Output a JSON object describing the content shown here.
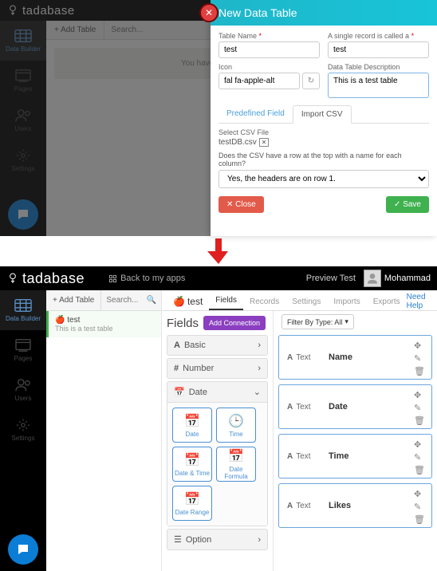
{
  "brand": "tadabase",
  "back_link": "Back to my apps",
  "sidebar": {
    "items": [
      {
        "label": "Data Builder"
      },
      {
        "label": "Pages"
      },
      {
        "label": "Users"
      },
      {
        "label": "Settings"
      }
    ]
  },
  "top": {
    "add_table": "+ Add Table",
    "search_placeholder": "Search...",
    "no_tables_msg": "You haven't created any tables yet"
  },
  "modal": {
    "title": "New Data Table",
    "table_name_label": "Table Name",
    "table_name_value": "test",
    "single_record_label": "A single record is called a",
    "single_record_value": "test",
    "icon_label": "Icon",
    "icon_value": "fal fa-apple-alt",
    "desc_label": "Data Table Description",
    "desc_value": "This is a test table",
    "tab_predefined": "Predefined Field",
    "tab_import": "Import CSV",
    "select_csv_label": "Select CSV File",
    "csv_file": "testDB.csv",
    "csv_question": "Does the CSV have a row at the top with a name for each column?",
    "csv_answer": "Yes, the headers are on row 1.",
    "close": "Close",
    "save": "Save"
  },
  "bottom": {
    "preview": "Preview Test",
    "username": "Mohammad",
    "add_table": "+ Add Table",
    "search_placeholder": "Search...",
    "table": {
      "name": "test",
      "desc": "This is a test table"
    },
    "tabs": [
      "Fields",
      "Records",
      "Settings",
      "Imports",
      "Exports"
    ],
    "need_help": "Need Help",
    "fields_title": "Fields",
    "add_connection": "Add Connection",
    "filter_label": "Filter By Type: All",
    "accordion": {
      "basic": "Basic",
      "number": "Number",
      "date": "Date",
      "option": "Option",
      "date_items": [
        "Date",
        "Time",
        "Date & Time",
        "Date Formula",
        "Date Range"
      ]
    },
    "fields": [
      {
        "type": "Text",
        "name": "Name"
      },
      {
        "type": "Text",
        "name": "Date"
      },
      {
        "type": "Text",
        "name": "Time"
      },
      {
        "type": "Text",
        "name": "Likes"
      }
    ]
  }
}
